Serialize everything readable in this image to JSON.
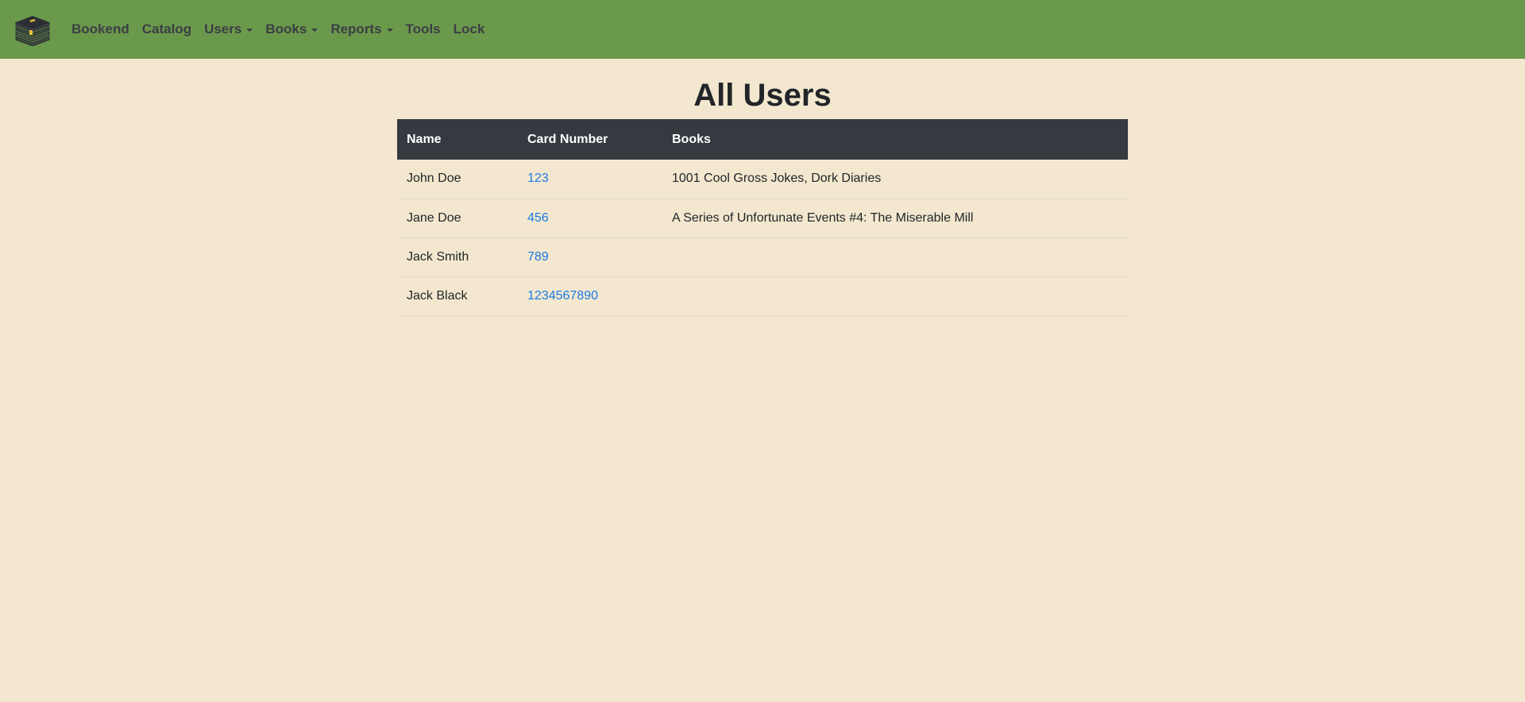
{
  "nav": {
    "logo_icon": "books-stack-icon",
    "items": [
      {
        "label": "Bookend",
        "dropdown": false
      },
      {
        "label": "Catalog",
        "dropdown": false
      },
      {
        "label": "Users",
        "dropdown": true
      },
      {
        "label": "Books",
        "dropdown": true
      },
      {
        "label": "Reports",
        "dropdown": true
      },
      {
        "label": "Tools",
        "dropdown": false
      },
      {
        "label": "Lock",
        "dropdown": false
      }
    ]
  },
  "page": {
    "title": "All Users"
  },
  "table": {
    "headers": [
      "Name",
      "Card Number",
      "Books"
    ],
    "rows": [
      {
        "name": "John Doe",
        "card": "123",
        "books": "1001 Cool Gross Jokes, Dork Diaries"
      },
      {
        "name": "Jane Doe",
        "card": "456",
        "books": "A Series of Unfortunate Events #4: The Miserable Mill"
      },
      {
        "name": "Jack Smith",
        "card": "789",
        "books": ""
      },
      {
        "name": "Jack Black",
        "card": "1234567890",
        "books": ""
      }
    ]
  },
  "colors": {
    "navbar": "#6b994c",
    "background": "#f3e8cf",
    "table_header": "#343a40",
    "link": "#1a7ae6"
  }
}
